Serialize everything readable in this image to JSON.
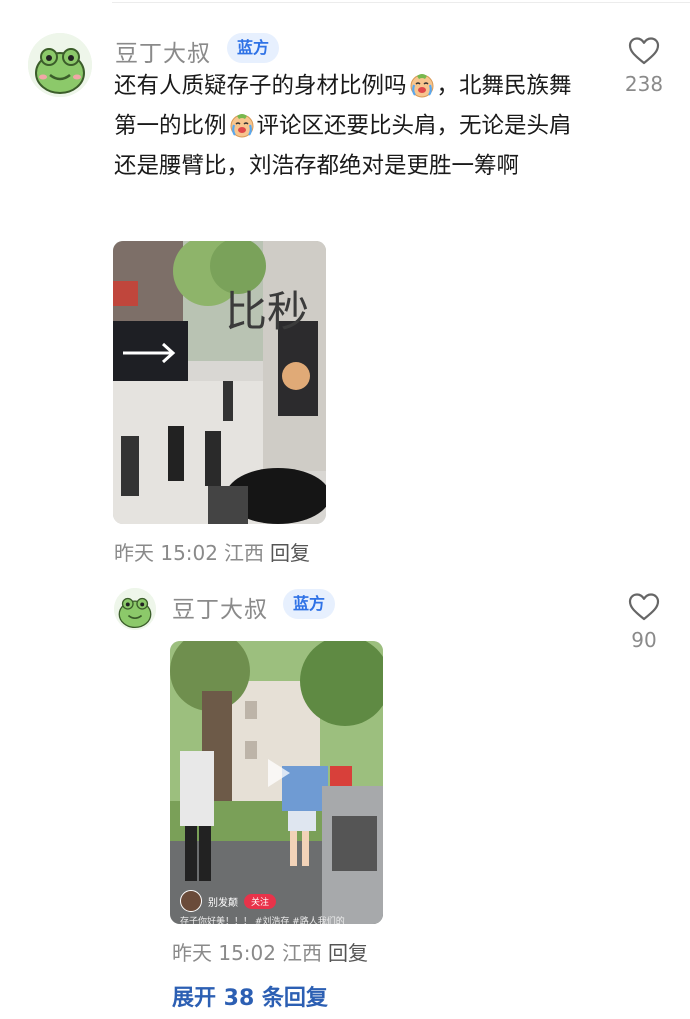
{
  "comment": {
    "username": "豆丁大叔",
    "badge": "蓝方",
    "text_parts": [
      "还有人质疑存子的身材比例吗",
      "，北舞民族舞第一的比例",
      "评论区还要比头肩，无论是头肩还是腰臂比，刘浩存都绝对是更胜一筹啊"
    ],
    "emoji_icon": "crying-laughing-face-icon",
    "like_count": "238",
    "photo_overlay_text": "比秒",
    "meta": {
      "time": "昨天 15:02",
      "location": "江西",
      "reply": "回复"
    }
  },
  "reply": {
    "username": "豆丁大叔",
    "badge": "蓝方",
    "like_count": "90",
    "video_overlay": {
      "name": "别发颠",
      "follow": "关注",
      "caption": "存子你好美！！！ #刘浩存 #路人我们的"
    },
    "meta": {
      "time": "昨天 15:02",
      "location": "江西",
      "reply": "回复"
    }
  },
  "expand_replies": "展开 38 条回复",
  "colors": {
    "badge_bg": "#e7f0fe",
    "badge_text": "#2f72e6",
    "link": "#2c5fb3",
    "muted": "#8a8a8a",
    "follow": "#e8334a"
  }
}
